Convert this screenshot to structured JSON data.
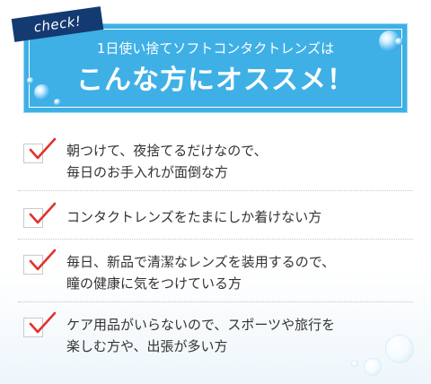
{
  "banner": {
    "tag": "check!",
    "subtitle": "1日使い捨てソフトコンタクトレンズは",
    "title": "こんな方にオススメ！"
  },
  "items": [
    {
      "line1": "朝つけて、夜捨てるだけなので、",
      "line2": "毎日のお手入れが面倒な方"
    },
    {
      "line1": "コンタクトレンズをたまにしか着けない方"
    },
    {
      "line1": "毎日、新品で清潔なレンズを装用するので、",
      "line2": "瞳の健康に気をつけている方"
    },
    {
      "line1": "ケア用品がいらないので、スポーツや旅行を",
      "line2": "楽しむ方や、出張が多い方"
    }
  ],
  "colors": {
    "banner": "#3fb0e6",
    "tag": "#143a72",
    "check": "#e0322e",
    "text": "#333333"
  },
  "icons": [
    "checkbox-icon",
    "checkmark-icon",
    "water-drop-icon"
  ]
}
